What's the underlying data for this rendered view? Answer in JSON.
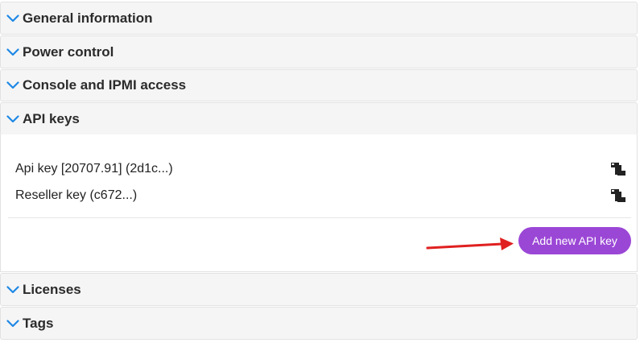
{
  "panels": {
    "general": {
      "label": "General information"
    },
    "power": {
      "label": "Power control"
    },
    "console": {
      "label": "Console and IPMI access"
    },
    "api": {
      "label": "API keys"
    },
    "licenses": {
      "label": "Licenses"
    },
    "tags": {
      "label": "Tags"
    }
  },
  "api_keys": {
    "items": [
      {
        "label": "Api key [20707.91] (2d1c...)",
        "icon": "copy-icon"
      },
      {
        "label": "Reseller key (c672...)",
        "icon": "copy-icon"
      }
    ],
    "add_button_label": "Add new API key"
  },
  "colors": {
    "chevron": "#1e88e5",
    "button": "#9b47d6",
    "arrow": "#e02020"
  }
}
